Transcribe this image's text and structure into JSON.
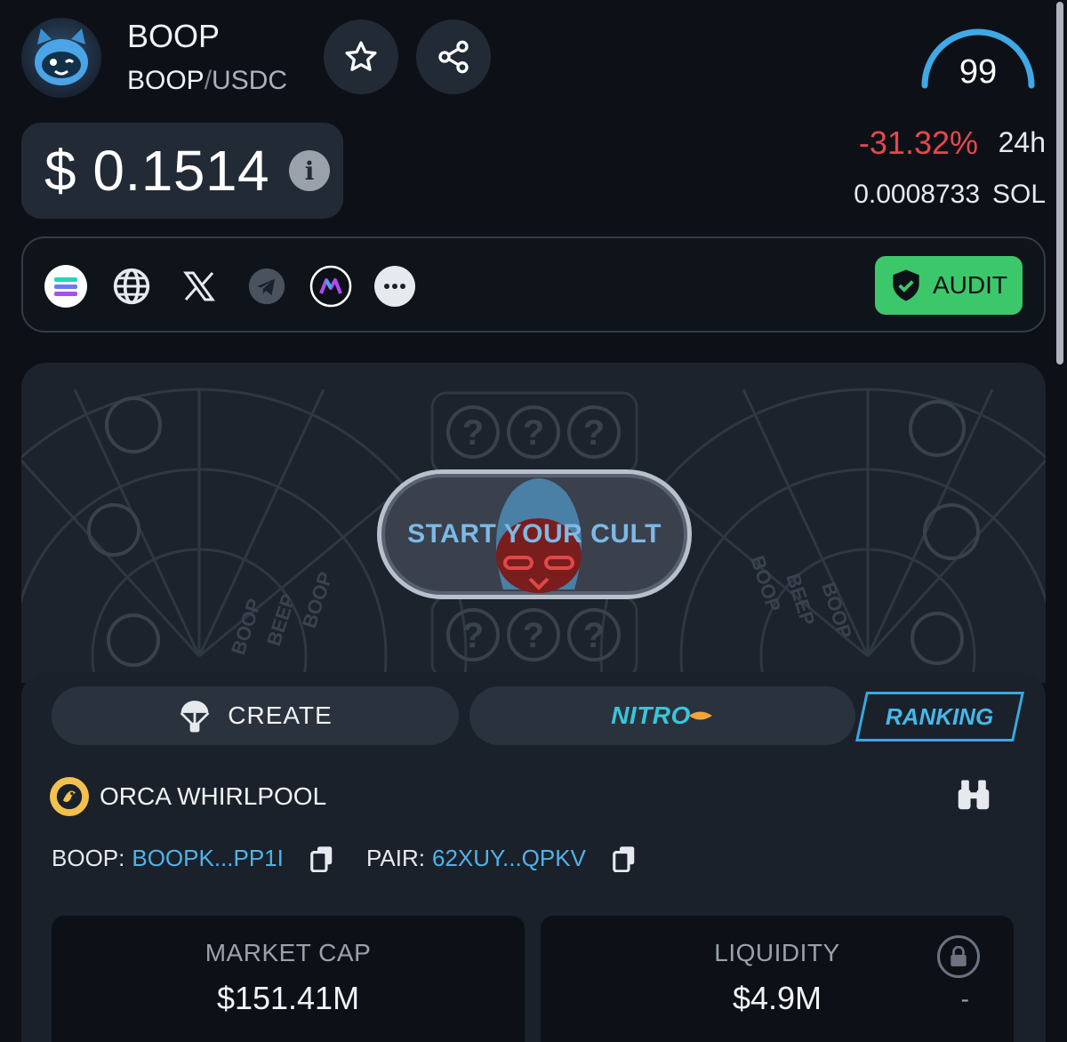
{
  "token": {
    "name": "BOOP",
    "base": "BOOP",
    "separator": "/",
    "quote": "USDC"
  },
  "score": "99",
  "price": {
    "usd": "$ 0.1514",
    "change": "-31.32%",
    "period": "24h",
    "native_value": "0.0008733",
    "native_symbol": "SOL"
  },
  "socials": {
    "icons": [
      "solana-icon",
      "website-globe-icon",
      "x-twitter-icon",
      "telegram-icon",
      "app-logo-icon",
      "more-icon"
    ],
    "audit_label": "AUDIT"
  },
  "banner": {
    "cta_label": "START YOUR CULT",
    "side_words": [
      "BOOP",
      "BEEP",
      "BOOP",
      "BEEP"
    ]
  },
  "tabs": {
    "create": "CREATE",
    "nitro": "NITRO",
    "ranking": "RANKING"
  },
  "pool": {
    "name": "ORCA WHIRLPOOL"
  },
  "addresses": {
    "token_label": "BOOP:",
    "token_value": "BOOPK...PP1I",
    "pair_label": "PAIR:",
    "pair_value": "62XUY...QPKV"
  },
  "stats": {
    "market_cap_label": "MARKET CAP",
    "market_cap_value": "$151.41M",
    "liquidity_label": "LIQUIDITY",
    "liquidity_value": "$4.9M",
    "liquidity_extra": "-"
  },
  "colors": {
    "negative": "#e5484d",
    "audit_green": "#3cc76a",
    "link_blue": "#4fb3e8",
    "nitro_cyan": "#38c6d9"
  }
}
